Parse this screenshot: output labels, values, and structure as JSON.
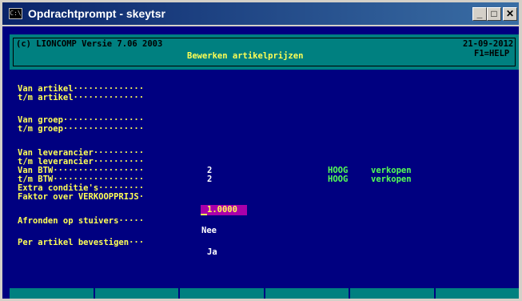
{
  "window": {
    "title": "Opdrachtprompt - skeytsr",
    "icon": "console-icon"
  },
  "header": {
    "copyright": "(c) LIONCOMP Versie 7.06 2003",
    "subtitle": "Bewerken artikelprijzen",
    "date": "21-09-2012",
    "help": "F1=HELP"
  },
  "form": {
    "van_artikel": "Van artikel··············",
    "tm_artikel": "t/m artikel··············",
    "van_groep": "Van groep················",
    "tm_groep": "t/m groep················",
    "van_leverancier": "Van leverancier··········",
    "tm_leverancier": "t/m leverancier··········",
    "van_btw": "Van BTW··················",
    "tm_btw": "t/m BTW··················",
    "extra_condities": "Extra conditie's·········",
    "faktor": "Faktor over VERKOOPPRIJS·",
    "afronden": "Afronden op stuivers·····",
    "per_artikel": "Per artikel bevestigen···"
  },
  "values": {
    "van_btw_code": "2",
    "van_btw_name": "HOOG",
    "van_btw_type": "verkopen",
    "tm_btw_code": "2",
    "tm_btw_name": "HOOG",
    "tm_btw_type": "verkopen",
    "faktor_value": "1.0000",
    "afronden_value": "Nee",
    "per_artikel_value": "Ja"
  },
  "colors": {
    "background": "#000080",
    "header": "#008080",
    "label": "#ffff55",
    "value": "#ffffff",
    "btw": "#55ff55",
    "field": "#aa00aa"
  }
}
